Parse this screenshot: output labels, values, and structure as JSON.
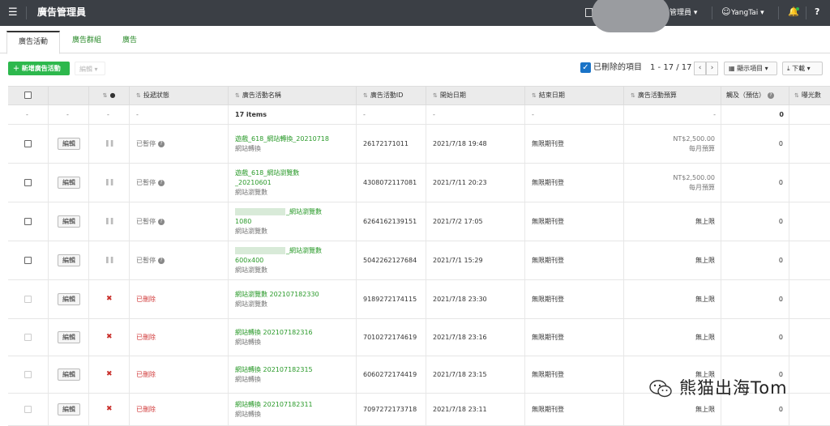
{
  "topbar": {
    "menu_icon": "hamburger-icon",
    "title": "廣告管理員",
    "account_label": "管理員 ▾",
    "user": "YangTai ▾",
    "notification_icon": "bell-icon",
    "help_icon": "help-icon"
  },
  "tabs": [
    {
      "label": "廣告活動",
      "active": true
    },
    {
      "label": "廣告群組",
      "active": false
    },
    {
      "label": "廣告",
      "active": false
    }
  ],
  "toolbar": {
    "create_label": "新增廣告活動",
    "edit_label": "編輯",
    "show_deleted_label": "已刪除的項目",
    "show_deleted_checked": true,
    "range": "1 - 17 / 17",
    "columns_label": "顯示項目",
    "download_label": "下載"
  },
  "table": {
    "headers": [
      "投遞狀態",
      "廣告活動名稱",
      "廣告活動ID",
      "開始日期",
      "結束日期",
      "廣告活動預算",
      "觸及（預估）",
      "曝光數"
    ],
    "summary": {
      "dash": "-",
      "name": "17 items",
      "reach": "0"
    },
    "edit_label": "編輯",
    "rows": [
      {
        "status": "已暫停",
        "status_type": "paused",
        "name_lines": [
          "遊戲_618_網站轉換_20210718"
        ],
        "blurred_prefix": false,
        "objective": "網站轉換",
        "id": "26172171011",
        "start": "2021/7/18 19:48",
        "end": "無限期刊登",
        "budget": "NT$2,500.00",
        "budget_note": "每月預算",
        "reach": "0"
      },
      {
        "status": "已暫停",
        "status_type": "paused",
        "name_lines": [
          "遊戲_618_網站瀏覽數",
          "_20210601"
        ],
        "blurred_prefix": false,
        "objective": "網站瀏覽數",
        "id": "4308072117081",
        "start": "2021/7/11 20:23",
        "end": "無限期刊登",
        "budget": "NT$2,500.00",
        "budget_note": "每月預算",
        "reach": "0"
      },
      {
        "status": "已暫停",
        "status_type": "paused",
        "name_lines": [
          "_網站瀏覽數",
          "1080"
        ],
        "blurred_prefix": true,
        "objective": "網站瀏覽數",
        "id": "6264162139151",
        "start": "2021/7/2 17:05",
        "end": "無限期刊登",
        "budget": "無上限",
        "budget_note": "",
        "reach": "0"
      },
      {
        "status": "已暫停",
        "status_type": "paused",
        "name_lines": [
          "_網站瀏覽數",
          "600x400"
        ],
        "blurred_prefix": true,
        "objective": "網站瀏覽數",
        "id": "5042262127684",
        "start": "2021/7/1 15:29",
        "end": "無限期刊登",
        "budget": "無上限",
        "budget_note": "",
        "reach": "0"
      },
      {
        "status": "已刪除",
        "status_type": "deleted",
        "name_lines": [
          "網站瀏覽數 202107182330"
        ],
        "blurred_prefix": false,
        "objective": "網站瀏覽數",
        "id": "9189272174115",
        "start": "2021/7/18 23:30",
        "end": "無限期刊登",
        "budget": "無上限",
        "budget_note": "",
        "reach": "0"
      },
      {
        "status": "已刪除",
        "status_type": "deleted",
        "name_lines": [
          "網站轉換 202107182316"
        ],
        "blurred_prefix": false,
        "objective": "網站轉換",
        "id": "7010272174619",
        "start": "2021/7/18 23:16",
        "end": "無限期刊登",
        "budget": "無上限",
        "budget_note": "",
        "reach": "0"
      },
      {
        "status": "已刪除",
        "status_type": "deleted",
        "name_lines": [
          "網站轉換 202107182315"
        ],
        "blurred_prefix": false,
        "objective": "網站轉換",
        "id": "6060272174419",
        "start": "2021/7/18 23:15",
        "end": "無限期刊登",
        "budget": "無上限",
        "budget_note": "",
        "reach": "0"
      },
      {
        "status": "已刪除",
        "status_type": "deleted",
        "name_lines": [
          "網站轉換 202107182311"
        ],
        "blurred_prefix": false,
        "objective": "網站轉換",
        "id": "7097272173718",
        "start": "2021/7/18 23:11",
        "end": "無限期刊登",
        "budget": "無上限",
        "budget_note": "",
        "reach": "0"
      }
    ]
  },
  "watermark": {
    "text": "熊猫出海Tom",
    "icon": "wechat-icon"
  }
}
